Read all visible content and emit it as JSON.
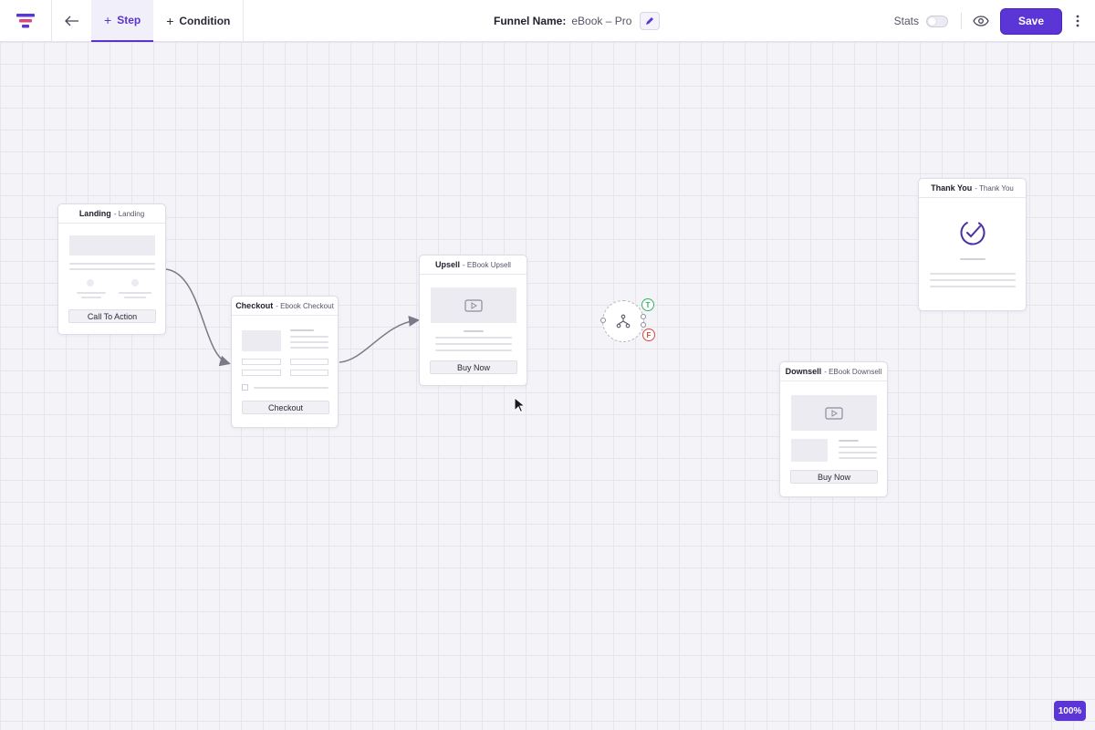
{
  "toolbar": {
    "tab_step": "Step",
    "tab_condition": "Condition",
    "funnel_label": "Funnel Name:",
    "funnel_value": "eBook – Pro",
    "stats_label": "Stats",
    "stats_enabled": false,
    "save_label": "Save"
  },
  "nodes": {
    "landing": {
      "title": "Landing",
      "subtitle": "- Landing",
      "button": "Call To Action"
    },
    "checkout": {
      "title": "Checkout",
      "subtitle": "- Ebook Checkout",
      "button": "Checkout"
    },
    "upsell": {
      "title": "Upsell",
      "subtitle": "- EBook Upsell",
      "button": "Buy Now"
    },
    "downsell": {
      "title": "Downsell",
      "subtitle": "- EBook Downsell",
      "button": "Buy Now"
    },
    "thankyou": {
      "title": "Thank You",
      "subtitle": "- Thank You"
    }
  },
  "condition": {
    "true_label": "T",
    "false_label": "F"
  },
  "zoom": "100%",
  "colors": {
    "accent": "#5b35d5",
    "true": "#2fb36a",
    "false": "#d6463e"
  },
  "icons": [
    "funnel-logo-icon",
    "arrow-left-icon",
    "plus-icon",
    "pencil-icon",
    "eye-icon",
    "more-vertical-icon",
    "play-icon",
    "check-circle-icon",
    "branch-icon",
    "cursor-icon"
  ]
}
